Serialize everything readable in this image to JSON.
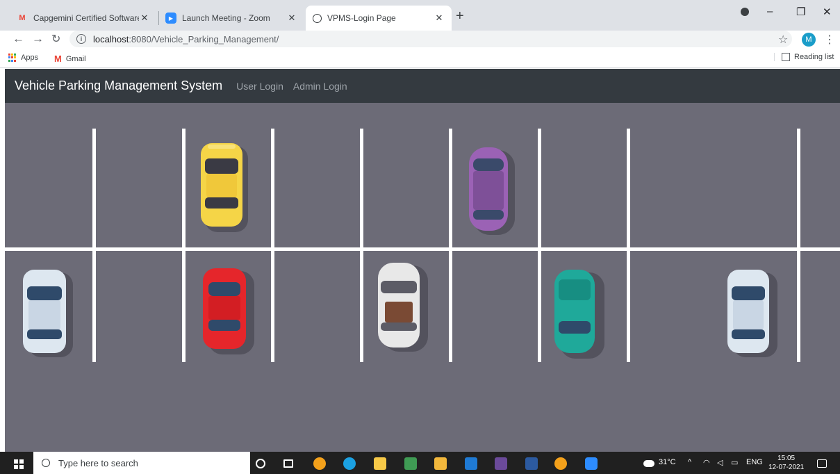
{
  "browser": {
    "tabs": [
      {
        "title": "Capgemini Certified Software De",
        "favicon": "gmail-icon",
        "active": false
      },
      {
        "title": "Launch Meeting - Zoom",
        "favicon": "zoom-icon",
        "active": false
      },
      {
        "title": "VPMS-Login Page",
        "favicon": "globe-icon",
        "active": true
      }
    ],
    "new_tab_label": "+",
    "url_host": "localhost",
    "url_path": ":8080/Vehicle_Parking_Management/",
    "profile_initial": "M",
    "bookmarks": [
      {
        "label": "Apps",
        "icon": "apps-grid-icon"
      },
      {
        "label": "Gmail",
        "icon": "gmail-icon"
      }
    ],
    "reading_list_label": "Reading list"
  },
  "app": {
    "brand": "Vehicle Parking Management System",
    "nav": [
      {
        "label": "User Login"
      },
      {
        "label": "Admin Login"
      }
    ]
  },
  "taskbar": {
    "search_placeholder": "Type here to search",
    "weather": "31°C",
    "language": "ENG",
    "time": "15:05",
    "date": "12-07-2021"
  },
  "colors": {
    "navbar": "#343a40",
    "asphalt": "#6c6b77",
    "car_yellow": "#f5d547",
    "car_purple": "#9b62b5",
    "car_red": "#e5262b",
    "car_white": "#e8e8e8",
    "car_teal": "#1fa99a",
    "car_lightblue": "#dde7f0"
  }
}
